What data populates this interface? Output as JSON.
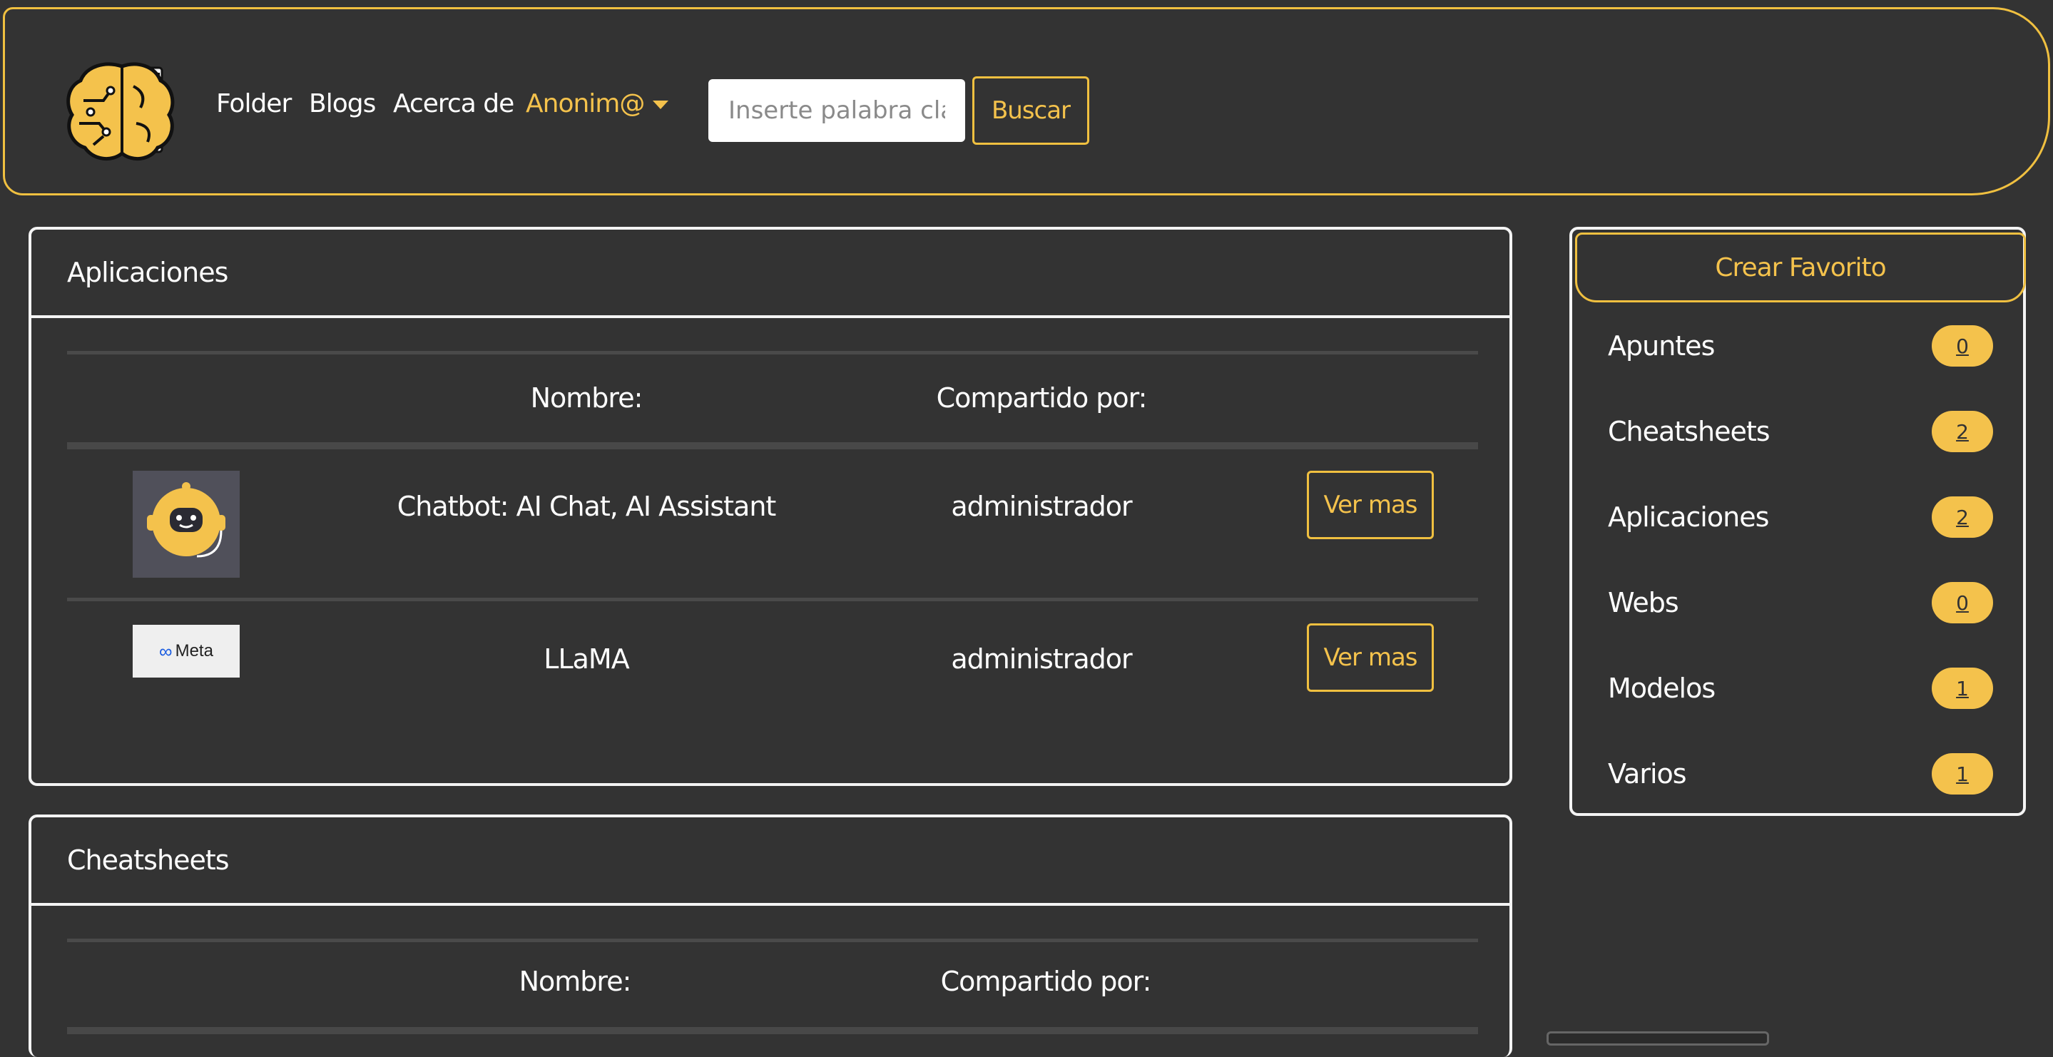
{
  "navbar": {
    "logo_icon": "brain-book-logo",
    "links": [
      "Folder",
      "Blogs",
      "Acerca de"
    ],
    "user_menu": "Anonim@",
    "search": {
      "placeholder": "Inserte palabra clave",
      "value": ""
    },
    "search_button": "Buscar"
  },
  "colors": {
    "background": "#333333",
    "accent": "#f4c24c",
    "border": "#f4f4f4"
  },
  "sections": [
    {
      "title": "Aplicaciones",
      "col_name": "Nombre:",
      "col_shared": "Compartido por:",
      "rows": [
        {
          "icon": "chatbot-robot-thumbnail",
          "name": "Chatbot: AI Chat, AI Assistant",
          "shared_by": "administrador",
          "button": "Ver mas"
        },
        {
          "icon": "meta-logo-thumbnail",
          "name": "LLaMA",
          "shared_by": "administrador",
          "button": "Ver mas",
          "logo_text": "Meta"
        }
      ]
    },
    {
      "title": "Cheatsheets",
      "col_name": "Nombre:",
      "col_shared": "Compartido por:"
    }
  ],
  "sidebar": {
    "button": "Crear Favorito",
    "items": [
      {
        "label": "Apuntes",
        "count": "0"
      },
      {
        "label": "Cheatsheets",
        "count": "2"
      },
      {
        "label": "Aplicaciones",
        "count": "2"
      },
      {
        "label": "Webs",
        "count": "0"
      },
      {
        "label": "Modelos",
        "count": "1"
      },
      {
        "label": "Varios",
        "count": "1"
      }
    ]
  }
}
